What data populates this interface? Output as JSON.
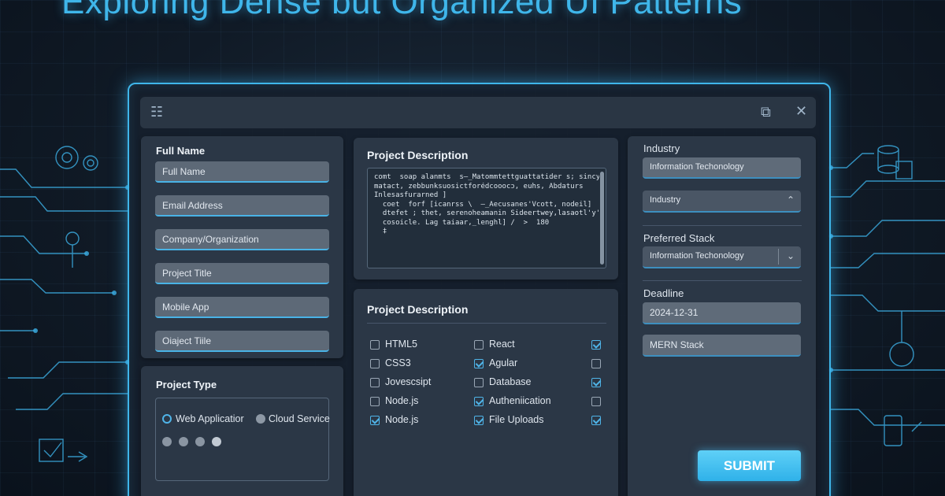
{
  "headline": "Exploring Dense but Organized UI Patterns",
  "left": {
    "full_name_label": "Full Name",
    "fields": [
      "Full Name",
      "Email Address",
      "Company/Organization",
      "Project Title",
      "Mobile App",
      "Oiaject Tiile"
    ]
  },
  "project_type": {
    "label": "Project Type",
    "options": [
      {
        "label": "Web Applicatior",
        "selected": true
      },
      {
        "label": "Cloud Service",
        "selected": false
      }
    ]
  },
  "description": {
    "label": "Project Description",
    "code_lines": [
      "comt  soap alanmts  s—_Matommtettguattatider s; sincy;t,",
      "matact, zebbunksuosictforédcooocɔ, euhs, Abdaturs",
      "Inlesasfurarned ]",
      "  coet  forf [icanrss \\  —_Aecusanes'Vcott, nodeil]",
      "  dtefet ; thet, serenoheamanin Sideertwey,lasaotl'y'ess",
      "  cosoicle. Lag taiaar,_lenghl] /  >  180",
      "  ‡"
    ]
  },
  "stack": {
    "label": "Project Description",
    "columns": [
      [
        {
          "label": "HTML5",
          "checked": false
        },
        {
          "label": "CSS3",
          "checked": false
        },
        {
          "label": "Jovescsipt",
          "checked": false
        },
        {
          "label": "Node.js",
          "checked": false
        },
        {
          "label": "Node.js",
          "checked": true
        }
      ],
      [
        {
          "label": "React",
          "checked": false
        },
        {
          "label": "Agular",
          "checked": true
        },
        {
          "label": "Database",
          "checked": false
        },
        {
          "label": "Autheniication",
          "checked": true
        },
        {
          "label": "File Uploads",
          "checked": true
        }
      ],
      [
        {
          "checked": true
        },
        {
          "checked": false
        },
        {
          "checked": true
        },
        {
          "checked": false
        },
        {
          "checked": true
        }
      ]
    ]
  },
  "right": {
    "industry_label": "Industry",
    "industry_value": "Information Techonology",
    "industry_select": "Industry",
    "preferred_label": "Preferred Stack",
    "preferred_value": "Information Techonology",
    "deadline_label": "Deadline",
    "deadline_value": "2024-12-31",
    "stack_value": "MERN Stack",
    "submit_label": "SUBMIT"
  },
  "colors": {
    "accent": "#3fb6ea",
    "panel": "#2b3746",
    "field": "#5d6977"
  }
}
